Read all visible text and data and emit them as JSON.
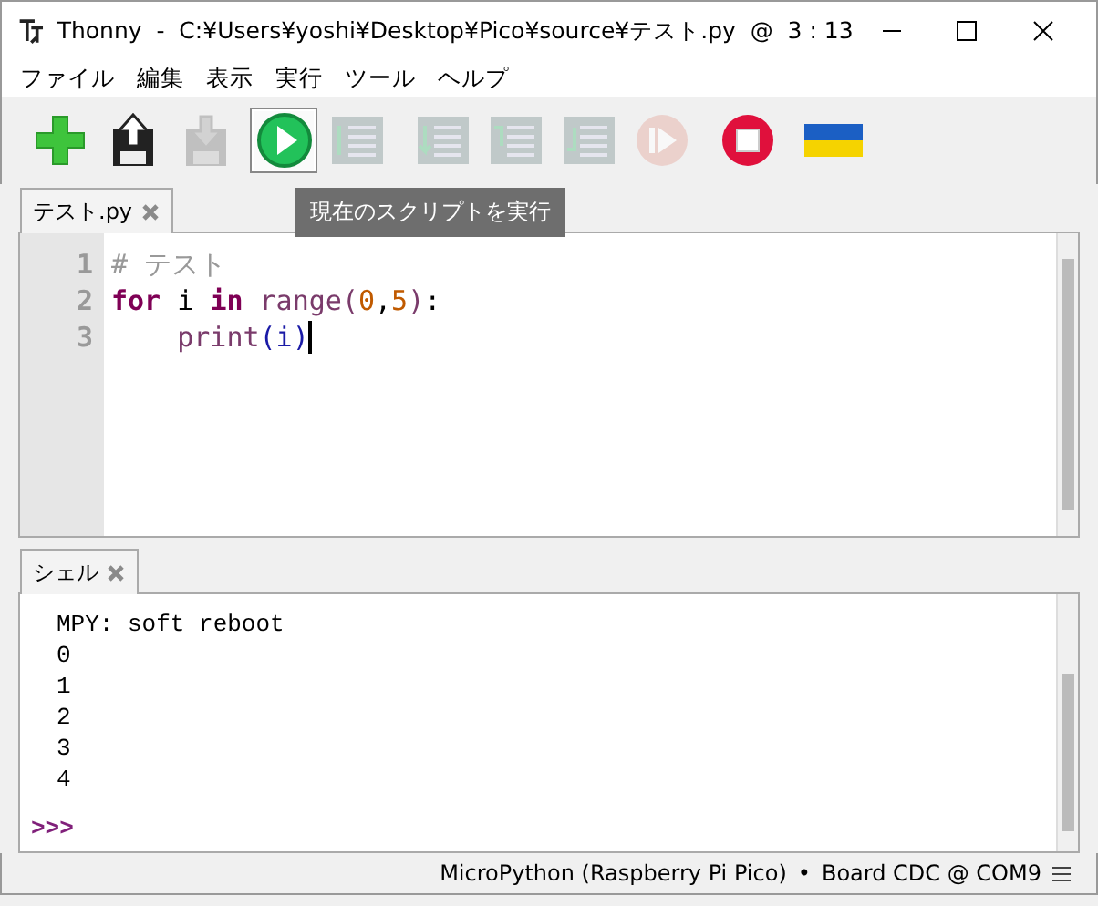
{
  "window": {
    "title": "Thonny  -  C:¥Users¥yoshi¥Desktop¥Pico¥source¥テスト.py  @  3 : 13"
  },
  "menu": [
    "ファイル",
    "編集",
    "表示",
    "実行",
    "ツール",
    "ヘルプ"
  ],
  "toolbar": {
    "buttons": [
      {
        "kind": "new",
        "disabled": false,
        "hovered": false
      },
      {
        "kind": "load",
        "disabled": false,
        "hovered": false
      },
      {
        "kind": "save",
        "disabled": true,
        "hovered": false
      },
      {
        "kind": "run",
        "disabled": false,
        "hovered": true
      },
      {
        "kind": "debug",
        "disabled": true,
        "hovered": false
      },
      {
        "kind": "step-over",
        "disabled": true,
        "hovered": false
      },
      {
        "kind": "step-into",
        "disabled": true,
        "hovered": false
      },
      {
        "kind": "step-out",
        "disabled": true,
        "hovered": false
      },
      {
        "kind": "resume",
        "disabled": true,
        "hovered": false
      },
      {
        "kind": "stop",
        "disabled": false,
        "hovered": false
      },
      {
        "kind": "flag",
        "disabled": false,
        "hovered": false
      }
    ],
    "tooltip": "現在のスクリプトを実行"
  },
  "editor": {
    "tab": {
      "label": "テスト.py",
      "selected": true
    },
    "lines": [
      {
        "number": "1",
        "cursor": false,
        "tokens": [
          {
            "kind": "comment",
            "text": "# テスト"
          }
        ]
      },
      {
        "number": "2",
        "cursor": false,
        "tokens": [
          {
            "kind": "keyword",
            "text": "for"
          },
          {
            "kind": "plain",
            "text": " i "
          },
          {
            "kind": "keyword",
            "text": "in"
          },
          {
            "kind": "builtin",
            "text": " range"
          },
          {
            "kind": "paren",
            "text": "("
          },
          {
            "kind": "number",
            "text": "0"
          },
          {
            "kind": "plain",
            "text": ","
          },
          {
            "kind": "number",
            "text": "5"
          },
          {
            "kind": "paren",
            "text": ")"
          },
          {
            "kind": "plain",
            "text": ":"
          }
        ]
      },
      {
        "number": "3",
        "cursor": true,
        "indented": true,
        "tokens": [
          {
            "kind": "builtin",
            "text": "print"
          },
          {
            "kind": "call",
            "text": "(i)"
          }
        ]
      }
    ]
  },
  "shell": {
    "tab": {
      "label": "シェル",
      "selected": true
    },
    "output": [
      "MPY: soft reboot",
      "0",
      "1",
      "2",
      "3",
      "4"
    ],
    "prompt": ">>>"
  },
  "status_bar": {
    "interpreter": "MicroPython (Raspberry Pi Pico)",
    "separator": "•",
    "port": "Board CDC @ COM9"
  }
}
